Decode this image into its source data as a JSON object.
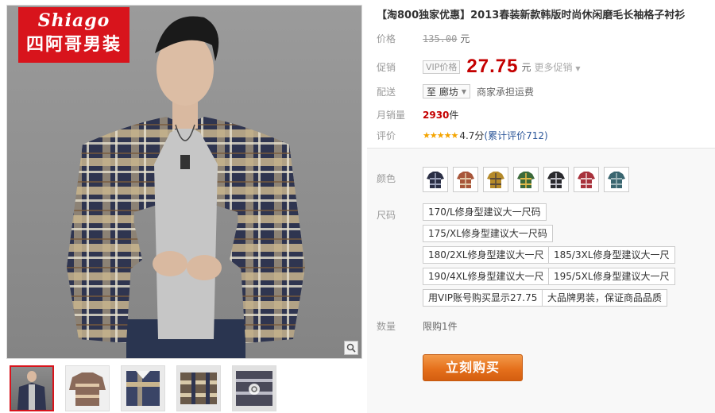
{
  "gallery": {
    "brand_logo": "Shiago",
    "brand_cn": "四阿哥男装",
    "zoom_icon": "zoom-icon",
    "thumbnails": [
      "model-front",
      "shirt-flat",
      "shirt-detail",
      "shirt-fold",
      "shirt-back"
    ]
  },
  "product": {
    "title": "【淘800独家优惠】2013春装新款韩版时尚休闲磨毛长袖格子衬衫",
    "price_label": "价格",
    "original_price": "135.00",
    "currency": "元",
    "promo_label": "促销",
    "vip_tag": "VIP价格",
    "promo_price": "27.75",
    "more_promo": "更多促销",
    "shipping_label": "配送",
    "shipping_dest": "至 廊坊",
    "shipping_note": "商家承担运费",
    "sales_label": "月销量",
    "sales_count": "2930",
    "sales_unit": "件",
    "rating_label": "评价",
    "stars": "★★★★★",
    "score": "4.7分",
    "review_link": "(累计评价712)"
  },
  "sku": {
    "color_label": "颜色",
    "colors": [
      {
        "name": "navy-check",
        "c1": "#2b2f45",
        "c2": "#9aa0b8"
      },
      {
        "name": "brown-check",
        "c1": "#a8563a",
        "c2": "#e0c7a8"
      },
      {
        "name": "mustard-check",
        "c1": "#b58a2a",
        "c2": "#5a4a3a"
      },
      {
        "name": "green-yellow-check",
        "c1": "#3c6a3a",
        "c2": "#e0b84a"
      },
      {
        "name": "black-check",
        "c1": "#2a2a2e",
        "c2": "#c0c0c8"
      },
      {
        "name": "red-check",
        "c1": "#a8323c",
        "c2": "#e6c6c8"
      },
      {
        "name": "teal-check",
        "c1": "#3a6670",
        "c2": "#9fb6ba"
      }
    ],
    "size_label": "尺码",
    "sizes": [
      "170/L修身型建议大一尺码",
      "175/XL修身型建议大一尺码",
      "180/2XL修身型建议大一尺",
      "185/3XL修身型建议大一尺",
      "190/4XL修身型建议大一尺",
      "195/5XL修身型建议大一尺",
      "用VIP账号购买显示27.75",
      "大品牌男装，保证商品品质"
    ],
    "qty_label": "数量",
    "qty_limit": "限购1件",
    "buy_label": "立刻购买"
  },
  "colors": {
    "accent_red": "#c40000",
    "brand_red": "#d8141c",
    "buy_orange": "#e5701c"
  }
}
